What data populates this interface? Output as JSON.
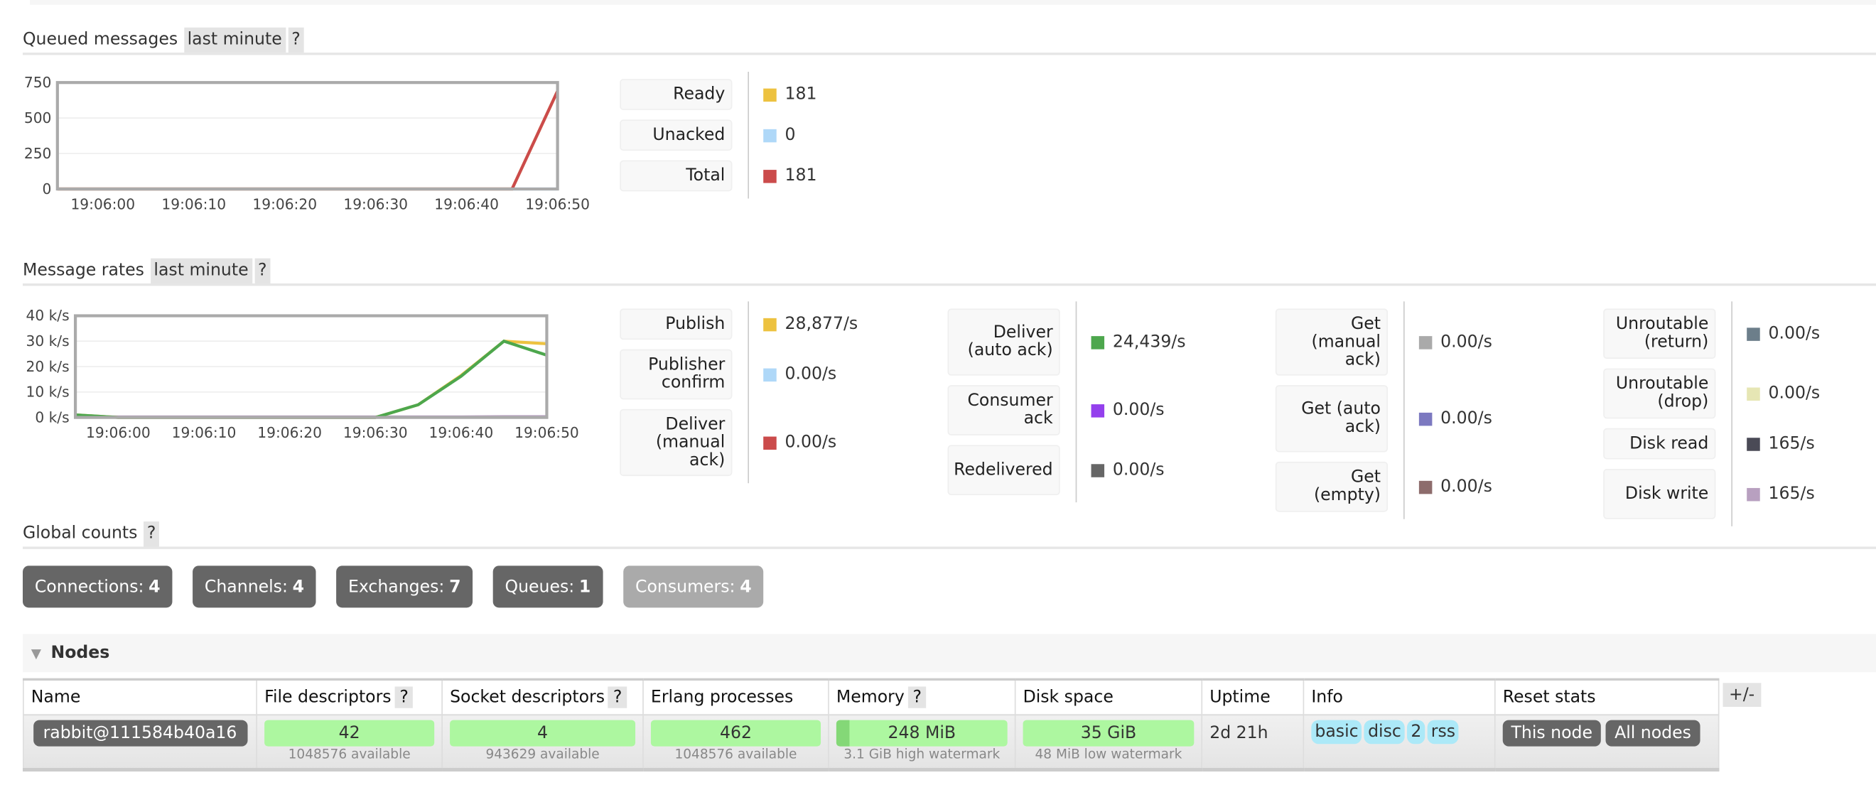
{
  "queued": {
    "title": "Queued messages",
    "range": "last minute",
    "help": "?",
    "legend": [
      {
        "label": "Ready",
        "value": "181",
        "color": "#edc240"
      },
      {
        "label": "Unacked",
        "value": "0",
        "color": "#afd8f8"
      },
      {
        "label": "Total",
        "value": "181",
        "color": "#cb4b4b"
      }
    ]
  },
  "rates": {
    "title": "Message rates",
    "range": "last minute",
    "help": "?",
    "legend": [
      [
        {
          "label": "Publish",
          "value": "28,877/s",
          "color": "#edc240"
        },
        {
          "label": "Publisher confirm",
          "value": "0.00/s",
          "color": "#afd8f8"
        },
        {
          "label": "Deliver (manual ack)",
          "value": "0.00/s",
          "color": "#cb4b4b"
        }
      ],
      [
        {
          "label": "Deliver (auto ack)",
          "value": "24,439/s",
          "color": "#4da74d"
        },
        {
          "label": "Consumer ack",
          "value": "0.00/s",
          "color": "#9440ed"
        },
        {
          "label": "Redelivered",
          "value": "0.00/s",
          "color": "#666666"
        }
      ],
      [
        {
          "label": "Get (manual ack)",
          "value": "0.00/s",
          "color": "#aaaaaa"
        },
        {
          "label": "Get (auto ack)",
          "value": "0.00/s",
          "color": "#7c79c0"
        },
        {
          "label": "Get (empty)",
          "value": "0.00/s",
          "color": "#8d6c6c"
        }
      ],
      [
        {
          "label": "Unroutable (return)",
          "value": "0.00/s",
          "color": "#6c7e8a"
        },
        {
          "label": "Unroutable (drop)",
          "value": "0.00/s",
          "color": "#e6e6b4"
        },
        {
          "label": "Disk read",
          "value": "165/s",
          "color": "#4a4a56"
        },
        {
          "label": "Disk write",
          "value": "165/s",
          "color": "#b8a0c0"
        }
      ]
    ]
  },
  "chart_data": [
    {
      "type": "line",
      "x": [
        "19:05:55",
        "19:06:00",
        "19:06:05",
        "19:06:10",
        "19:06:15",
        "19:06:20",
        "19:06:25",
        "19:06:30",
        "19:06:35",
        "19:06:40",
        "19:06:45",
        "19:06:50"
      ],
      "xticks": [
        "19:06:00",
        "19:06:10",
        "19:06:20",
        "19:06:30",
        "19:06:40",
        "19:06:50"
      ],
      "yticks": [
        "0",
        "250",
        "500",
        "750"
      ],
      "ylim": [
        0,
        750
      ],
      "grid": true,
      "series": [
        {
          "name": "Ready",
          "color": "#edc240",
          "values": [
            0,
            0,
            0,
            0,
            0,
            0,
            0,
            0,
            0,
            0,
            0,
            690
          ]
        },
        {
          "name": "Unacked",
          "color": "#afd8f8",
          "values": [
            0,
            0,
            0,
            0,
            0,
            0,
            0,
            0,
            0,
            0,
            0,
            0
          ]
        },
        {
          "name": "Total",
          "color": "#cb4b4b",
          "values": [
            0,
            0,
            0,
            0,
            0,
            0,
            0,
            0,
            0,
            0,
            0,
            690
          ]
        }
      ]
    },
    {
      "type": "line",
      "x": [
        "19:05:55",
        "19:06:00",
        "19:06:05",
        "19:06:10",
        "19:06:15",
        "19:06:20",
        "19:06:25",
        "19:06:30",
        "19:06:35",
        "19:06:40",
        "19:06:45",
        "19:06:50"
      ],
      "xticks": [
        "19:06:00",
        "19:06:10",
        "19:06:20",
        "19:06:30",
        "19:06:40",
        "19:06:50"
      ],
      "yticks": [
        "0 k/s",
        "10 k/s",
        "20 k/s",
        "30 k/s",
        "40 k/s"
      ],
      "ylim": [
        0,
        40000
      ],
      "grid": true,
      "series": [
        {
          "name": "Disk write",
          "color": "#b8a0c0",
          "values": [
            200,
            200,
            200,
            200,
            200,
            200,
            200,
            200,
            200,
            200,
            300,
            300
          ]
        },
        {
          "name": "Publish",
          "color": "#edc240",
          "values": [
            1000,
            0,
            0,
            0,
            0,
            0,
            0,
            0,
            5000,
            16500,
            30000,
            29000
          ]
        },
        {
          "name": "Deliver (auto ack)",
          "color": "#4da74d",
          "values": [
            1000,
            0,
            0,
            0,
            0,
            0,
            0,
            0,
            5000,
            16200,
            30000,
            24500
          ]
        }
      ]
    }
  ],
  "global": {
    "title": "Global counts",
    "help": "?",
    "items": [
      {
        "label": "Connections:",
        "value": "4"
      },
      {
        "label": "Channels:",
        "value": "4"
      },
      {
        "label": "Exchanges:",
        "value": "7"
      },
      {
        "label": "Queues:",
        "value": "1"
      },
      {
        "label": "Consumers:",
        "value": "4"
      }
    ]
  },
  "nodes": {
    "title": "Nodes",
    "toggle": "+/-",
    "headers": [
      "Name",
      "File descriptors",
      "Socket descriptors",
      "Erlang processes",
      "Memory",
      "Disk space",
      "Uptime",
      "Info",
      "Reset stats"
    ],
    "help": "?",
    "row": {
      "name": "rabbit@111584b40a16",
      "fd": "42",
      "fd_sub": "1048576 available",
      "sd": "4",
      "sd_sub": "943629 available",
      "ep": "462",
      "ep_sub": "1048576 available",
      "mem": "248 MiB",
      "mem_sub": "3.1 GiB high watermark",
      "mem_fraction": 0.08,
      "disk": "35 GiB",
      "disk_sub": "48 MiB low watermark",
      "uptime": "2d 21h",
      "info": [
        "basic",
        "disc",
        "2",
        "rss"
      ],
      "reset_this": "This node",
      "reset_all": "All nodes"
    }
  }
}
